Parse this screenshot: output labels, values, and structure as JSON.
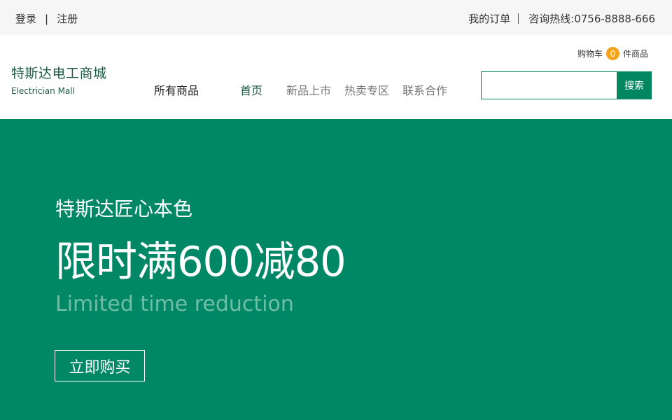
{
  "topbar": {
    "login": "登录",
    "separator": "|",
    "register": "注册",
    "orders": "我的订单",
    "hotline": "咨询热线:0756-8888-666"
  },
  "header": {
    "brand_title": "特斯达电工商城",
    "brand_subtitle": "Electrician Mall",
    "nav": {
      "all_products": "所有商品",
      "home": "首页",
      "new_arrivals": "新品上市",
      "hot_sale": "热卖专区",
      "contact": "联系合作"
    },
    "cart": {
      "label": "购物车",
      "count": "0",
      "suffix": "件商品"
    },
    "search": {
      "value": "",
      "placeholder": "",
      "button": "搜索"
    }
  },
  "banner": {
    "tagline": "特斯达匠心本色",
    "headline": "限时满600减80",
    "subline": "Limited time reduction",
    "cta": "立即购买"
  },
  "colors": {
    "brand_green": "#008766",
    "brand_dark_green": "#1f5b45",
    "badge_orange": "#f5a21a",
    "topbar_bg": "#f6f6f6"
  }
}
